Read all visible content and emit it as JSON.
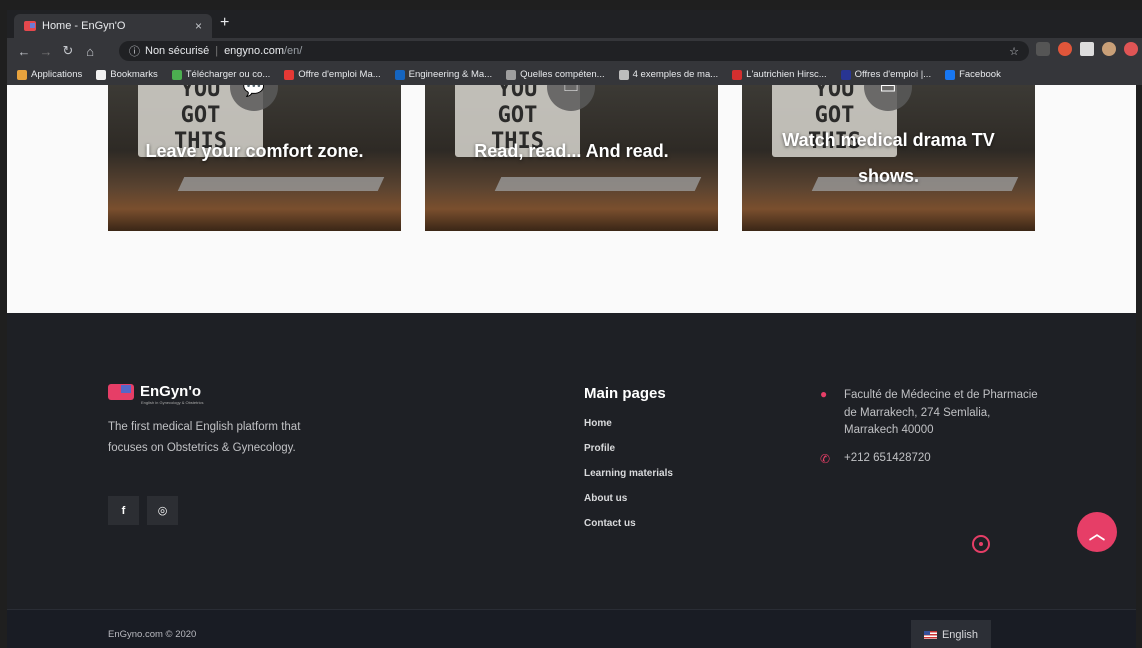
{
  "browser": {
    "tab_title": "Home - EnGyn'O",
    "tab_close": "×",
    "new_tab": "+",
    "security_label": "Non sécurisé",
    "url_domain": "engyno.com",
    "url_path": "/en/",
    "bookmarks": [
      {
        "label": "Applications",
        "color": "#e8a33d"
      },
      {
        "label": "Bookmarks",
        "color": "#f1f1f1"
      },
      {
        "label": "Télécharger ou co...",
        "color": "#4caf50"
      },
      {
        "label": "Offre d'emploi Ma...",
        "color": "#e53935"
      },
      {
        "label": "Engineering & Ma...",
        "color": "#1565c0"
      },
      {
        "label": "Quelles compéten...",
        "color": "#9e9e9e"
      },
      {
        "label": "4 exemples de ma...",
        "color": "#bdbdbd"
      },
      {
        "label": "L'autrichien Hirsc...",
        "color": "#d32f2f"
      },
      {
        "label": "Offres d'emploi |...",
        "color": "#283593"
      },
      {
        "label": "Facebook",
        "color": "#1877f2"
      }
    ]
  },
  "cards": [
    {
      "title": "Leave your comfort zone.",
      "icon": "chat-icon",
      "board_text": "YOU GOT THIS"
    },
    {
      "title": "Read, read... And read.",
      "icon": "document-icon",
      "board_text": "YOU GOT THIS"
    },
    {
      "title": "Watch medical drama TV shows.",
      "icon": "tv-icon",
      "board_text": "YOU GOT THIS"
    }
  ],
  "footer": {
    "brand_name": "EnGyn'o",
    "brand_tagline": "English in Gynecology & Obstetrics",
    "about_text": "The first medical English platform that focuses on Obstetrics & Gynecology.",
    "social": [
      {
        "name": "facebook-icon",
        "glyph": "f"
      },
      {
        "name": "instagram-icon",
        "glyph": "◎"
      }
    ],
    "main_pages_title": "Main pages",
    "links": [
      "Home",
      "Profile",
      "Learning materials",
      "About us",
      "Contact us"
    ],
    "address": "Faculté de Médecine et de Pharmacie de Marrakech, 274 Semlalia, Marrakech 40000",
    "phone": "+212 651428720",
    "copyright": "EnGyno.com © 2020",
    "language": "English"
  },
  "colors": {
    "accent": "#e63e67",
    "footer_bg": "#1e2025"
  }
}
